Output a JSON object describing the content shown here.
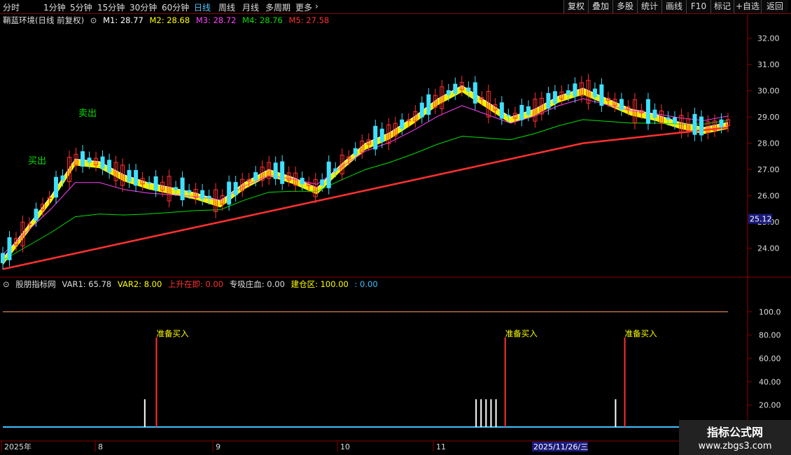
{
  "toolbar": {
    "periods": [
      "分时",
      "1分钟",
      "5分钟",
      "15分钟",
      "30分钟",
      "60分钟",
      "日线",
      "周线",
      "月线",
      "多周期",
      "更多"
    ],
    "active_period": "日线",
    "buttons": [
      "复权",
      "叠加",
      "多股",
      "统计",
      "画线",
      "F10",
      "标记",
      "+自选",
      "返回"
    ]
  },
  "main_info": {
    "title": "鞘蓝环境(日线 前复权)",
    "m1": "M1: 28.77",
    "m2": "M2: 28.68",
    "m3": "M3: 28.72",
    "m4": "M4: 28.76",
    "m5": "M5: 27.58"
  },
  "sub_info": {
    "title": "股朋指标网",
    "var1": "VAR1: 65.78",
    "var2": "VAR2: 8.00",
    "rise": "上升在即: 0.00",
    "absorb": "专吸庄血: 0.00",
    "build": "建仓区: 100.00",
    "build2": ": 0.00"
  },
  "colors": {
    "m1": "#ffffff",
    "m2": "#ffff00",
    "m3": "#ff40ff",
    "m4": "#00e000",
    "m5": "#ff3030",
    "up": "#ff3030",
    "down": "#40e0ff",
    "band_yellow": "#ffff00",
    "band_blue": "#2020ff"
  },
  "chart_data": {
    "type": "line",
    "ylim": [
      23.0,
      32.5
    ],
    "yticks": [
      "32.00",
      "31.00",
      "30.00",
      "29.00",
      "28.00",
      "27.00",
      "26.00",
      "25.00",
      "24.00"
    ],
    "current_price_tag": "25.12",
    "sub_ylim": [
      0,
      120
    ],
    "sub_yticks": [
      "100.0",
      "80.00",
      "60.00",
      "40.00",
      "20.00"
    ],
    "x_labels": [
      "2025年",
      "8",
      "9",
      "10",
      "11",
      "2025/11/26/三"
    ],
    "signals": [
      {
        "label": "准备买入",
        "x_index": 60
      },
      {
        "label": "准备买入",
        "x_index": 200
      },
      {
        "label": "准备买入",
        "x_index": 248
      }
    ],
    "chart_marks": [
      "买出",
      "卖出"
    ],
    "series": [
      {
        "name": "M1",
        "values": [
          23.6,
          24.8,
          26.0,
          27.4,
          27.3,
          26.8,
          26.5,
          26.3,
          26.1,
          25.8,
          26.5,
          27.0,
          26.7,
          26.3,
          27.2,
          28.0,
          28.4,
          29.0,
          29.7,
          30.2,
          29.6,
          29.0,
          29.3,
          29.8,
          30.1,
          29.7,
          29.3,
          29.1,
          28.8,
          28.6,
          28.8
        ]
      },
      {
        "name": "M5",
        "values": [
          23.2,
          23.4,
          23.6,
          23.8,
          24.0,
          24.2,
          24.4,
          24.6,
          24.8,
          25.0,
          25.2,
          25.4,
          25.6,
          25.8,
          26.0,
          26.2,
          26.4,
          26.6,
          26.8,
          27.0,
          27.2,
          27.4,
          27.6,
          27.8,
          28.0,
          28.1,
          28.2,
          28.3,
          28.4,
          28.5,
          28.6
        ]
      }
    ],
    "var_bars": [
      {
        "x_index": 57,
        "value": 25
      },
      {
        "x_index": 190,
        "value": 25
      },
      {
        "x_index": 192,
        "value": 25
      },
      {
        "x_index": 194,
        "value": 25
      },
      {
        "x_index": 196,
        "value": 25
      },
      {
        "x_index": 198,
        "value": 25
      },
      {
        "x_index": 246,
        "value": 25
      }
    ]
  },
  "watermark": {
    "line1": "指标公式网",
    "line2": "www.zbgs3.com"
  }
}
